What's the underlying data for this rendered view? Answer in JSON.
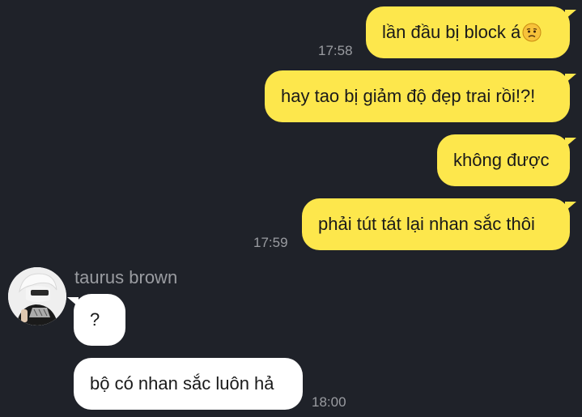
{
  "messages": [
    {
      "id": "m1",
      "direction": "outgoing",
      "text": "lần đầu bị block á",
      "emoji": "worried-face-icon"
    },
    {
      "id": "m2",
      "direction": "outgoing",
      "text": "hay tao bị giảm độ đẹp trai rồi!?!"
    },
    {
      "id": "m3",
      "direction": "outgoing",
      "text": "không được"
    },
    {
      "id": "m4",
      "direction": "outgoing",
      "text": "phải tút tát lại nhan sắc thôi"
    },
    {
      "id": "m5",
      "direction": "incoming",
      "text": "?"
    },
    {
      "id": "m6",
      "direction": "incoming",
      "text": "bộ có nhan sắc luôn hả"
    }
  ],
  "timestamps": {
    "t1": "17:58",
    "t2": "17:59",
    "t3": "18:00"
  },
  "sender": {
    "name": "taurus brown"
  },
  "colors": {
    "background": "#1f2229",
    "outgoing_bubble": "#fde74c",
    "incoming_bubble": "#ffffff",
    "timestamp": "#9a9ca1"
  }
}
